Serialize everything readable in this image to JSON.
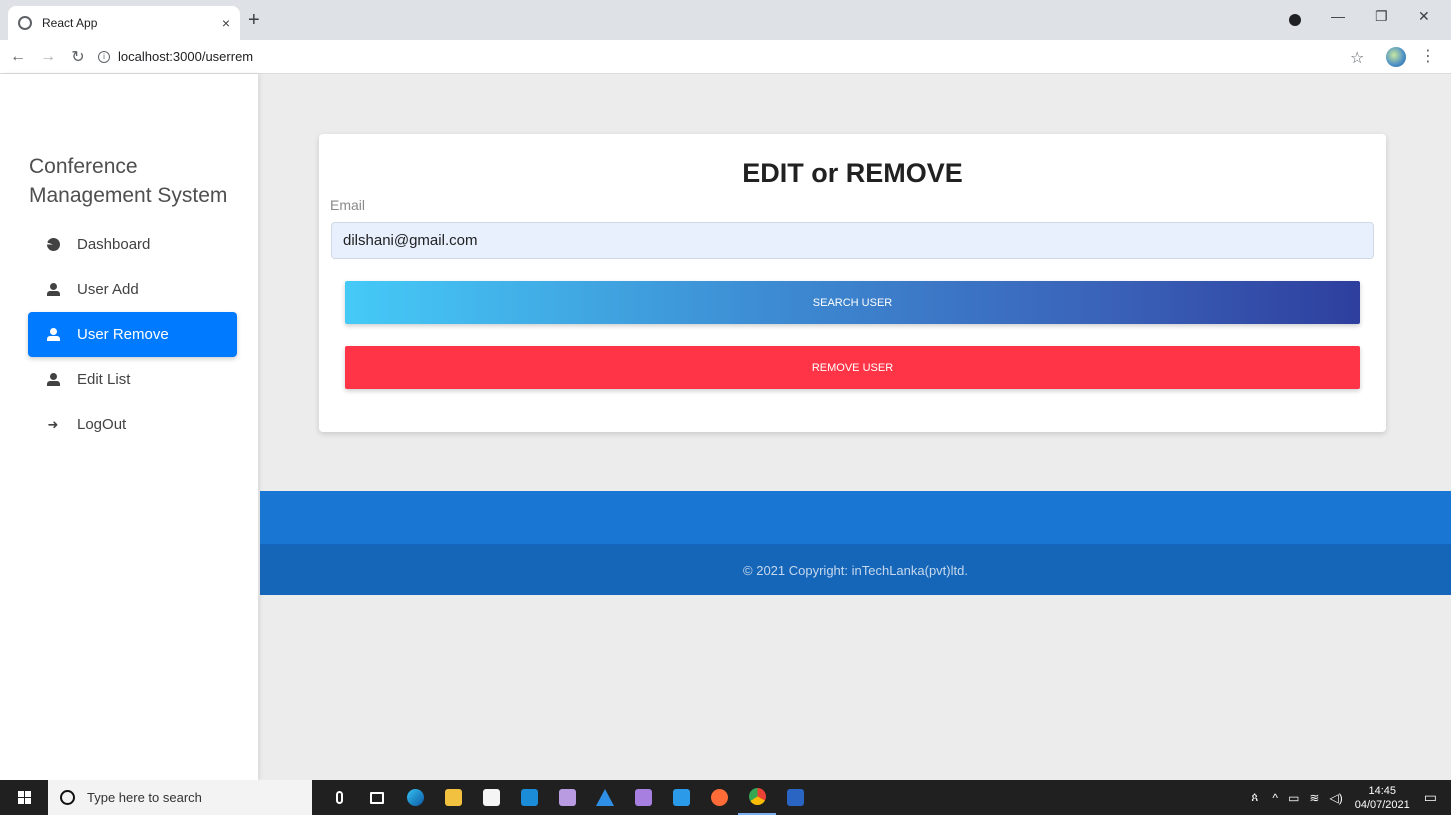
{
  "browser": {
    "tab_title": "React App",
    "url": "localhost:3000/userrem"
  },
  "sidebar": {
    "brand_line1": "Conference",
    "brand_line2": "Management System",
    "items": [
      {
        "label": "Dashboard",
        "icon": "pie-chart-icon",
        "active": false
      },
      {
        "label": "User Add",
        "icon": "user-icon",
        "active": false
      },
      {
        "label": "User Remove",
        "icon": "user-icon",
        "active": true
      },
      {
        "label": "Edit List",
        "icon": "user-icon",
        "active": false
      },
      {
        "label": "LogOut",
        "icon": "sign-out-icon",
        "active": false
      }
    ]
  },
  "main": {
    "title": "EDIT or REMOVE",
    "email_label": "Email",
    "email_value": "dilshani@gmail.com",
    "search_button": "SEARCH USER",
    "remove_button": "REMOVE USER"
  },
  "footer": {
    "copyright": "© 2021 Copyright: inTechLanka(pvt)ltd."
  },
  "taskbar": {
    "search_placeholder": "Type here to search",
    "time": "14:45",
    "date": "04/07/2021"
  },
  "colors": {
    "active_nav": "#007bff",
    "remove_button": "#ff3547",
    "footer_top": "#1976d2",
    "footer_bottom": "#1565b8"
  }
}
